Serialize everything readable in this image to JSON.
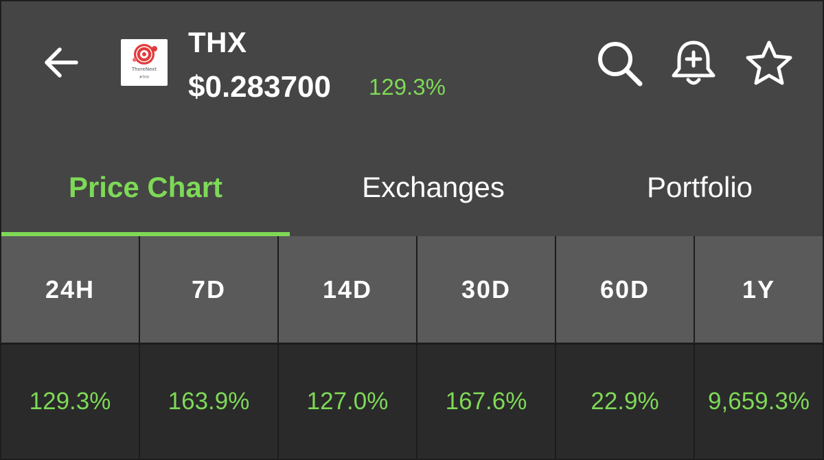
{
  "header": {
    "coin_symbol": "THX",
    "price": "$0.283700",
    "change_24h": "129.3%",
    "logo": {
      "brand_text": "ThoreNext",
      "ticker_text": "#THX"
    },
    "icons": [
      "back-arrow-icon",
      "search-icon",
      "bell-plus-icon",
      "star-icon"
    ]
  },
  "tabs": [
    {
      "label": "Price Chart",
      "active": true
    },
    {
      "label": "Exchanges",
      "active": false
    },
    {
      "label": "Portfolio",
      "active": false
    }
  ],
  "periods": [
    {
      "label": "24H",
      "value": "129.3%"
    },
    {
      "label": "7D",
      "value": "163.9%"
    },
    {
      "label": "14D",
      "value": "127.0%"
    },
    {
      "label": "30D",
      "value": "167.6%"
    },
    {
      "label": "60D",
      "value": "22.9%"
    },
    {
      "label": "1Y",
      "value": "9,659.3%"
    }
  ],
  "colors": {
    "accent_green": "#7ed957",
    "background": "#454545",
    "period_header_bg": "#5a5a5a",
    "period_value_bg": "#2a2a2a",
    "text": "#ffffff"
  }
}
